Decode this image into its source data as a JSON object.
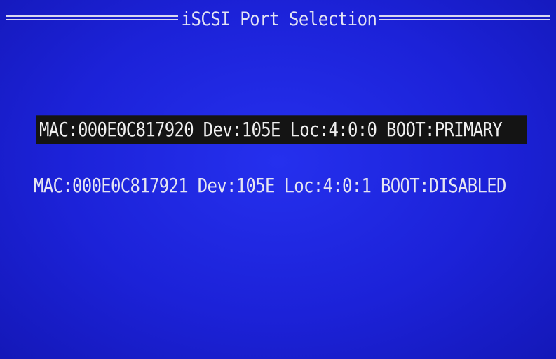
{
  "header": {
    "title": "iSCSI Port Selection"
  },
  "ports": [
    {
      "text": "MAC:000E0C817920 Dev:105E Loc:4:0:0 BOOT:PRIMARY",
      "selected": true
    },
    {
      "text": "MAC:000E0C817921 Dev:105E Loc:4:0:1 BOOT:DISABLED",
      "selected": false
    }
  ],
  "colors": {
    "background": "#1c22d8",
    "highlight": "#141414",
    "text": "#e8e8f4"
  }
}
